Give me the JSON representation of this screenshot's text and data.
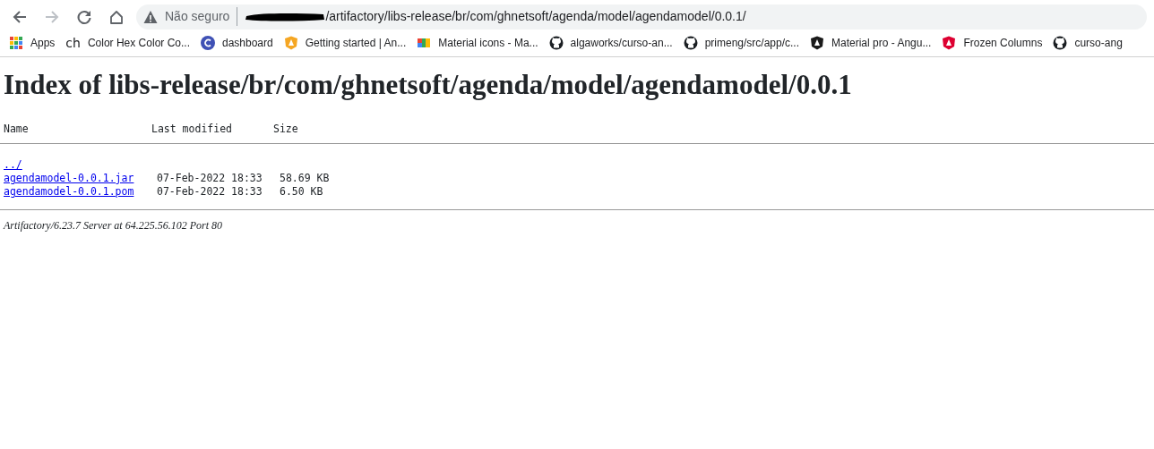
{
  "browser": {
    "back_disabled": false,
    "forward_disabled": true,
    "security_label": "Não seguro",
    "url": "/artifactory/libs-release/br/com/ghnetsoft/agenda/model/agendamodel/0.0.1/",
    "url_redacted": true
  },
  "bookmarks": [
    {
      "kind": "apps",
      "label": "Apps"
    },
    {
      "kind": "letters",
      "icon_text": "ch",
      "label": "Color Hex Color Co..."
    },
    {
      "kind": "disc",
      "color": "#3f51b5",
      "label": "dashboard"
    },
    {
      "kind": "shield",
      "color": "#f5a623",
      "label": "Getting started | An..."
    },
    {
      "kind": "tiles",
      "label": "Material icons - Ma..."
    },
    {
      "kind": "github",
      "label": "algaworks/curso-an..."
    },
    {
      "kind": "github",
      "label": "primeng/src/app/c..."
    },
    {
      "kind": "shield",
      "color": "#1a1a1a",
      "label": "Material pro - Angu..."
    },
    {
      "kind": "shield",
      "color": "#dd0031",
      "label": "Frozen Columns"
    },
    {
      "kind": "github",
      "label": "curso-ang"
    }
  ],
  "page": {
    "title": "Index of libs-release/br/com/ghnetsoft/agenda/model/agendamodel/0.0.1",
    "columns": [
      "Name",
      "Last modified",
      "Size"
    ],
    "rows": [
      {
        "name": "../"
      },
      {
        "name": "agendamodel-0.0.1.jar",
        "modified": "07-Feb-2022 18:33",
        "size": "58.69 KB"
      },
      {
        "name": "agendamodel-0.0.1.pom",
        "modified": "07-Feb-2022 18:33",
        "size": "6.50 KB"
      }
    ],
    "footer": "Artifactory/6.23.7 Server at 64.225.56.102 Port 80"
  }
}
